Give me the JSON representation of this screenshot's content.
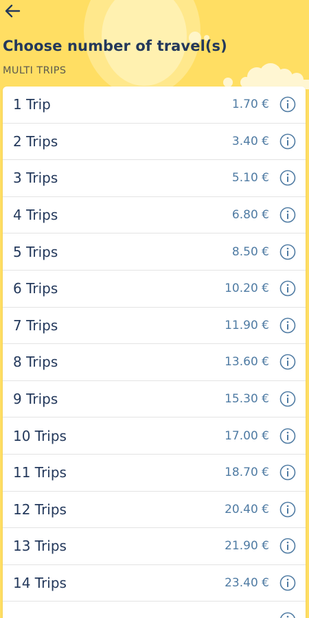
{
  "header": {
    "title": "Choose number of travel(s)",
    "section": "MULTI TRIPS"
  },
  "icons": {
    "back": "arrow-left-icon",
    "info": "info-circle-icon"
  },
  "colors": {
    "background": "#FFDE63",
    "title": "#23385B",
    "price": "#4F7BA3"
  },
  "trips": [
    {
      "label": "1 Trip",
      "price": "1.70 €"
    },
    {
      "label": "2 Trips",
      "price": "3.40 €"
    },
    {
      "label": "3 Trips",
      "price": "5.10 €"
    },
    {
      "label": "4 Trips",
      "price": "6.80 €"
    },
    {
      "label": "5 Trips",
      "price": "8.50 €"
    },
    {
      "label": "6 Trips",
      "price": "10.20 €"
    },
    {
      "label": "7 Trips",
      "price": "11.90 €"
    },
    {
      "label": "8 Trips",
      "price": "13.60 €"
    },
    {
      "label": "9 Trips",
      "price": "15.30 €"
    },
    {
      "label": "10 Trips",
      "price": "17.00 €"
    },
    {
      "label": "11 Trips",
      "price": "18.70 €"
    },
    {
      "label": "12 Trips",
      "price": "20.40 €"
    },
    {
      "label": "13 Trips",
      "price": "21.90 €"
    },
    {
      "label": "14 Trips",
      "price": "23.40 €"
    },
    {
      "label": "",
      "price": ""
    }
  ]
}
